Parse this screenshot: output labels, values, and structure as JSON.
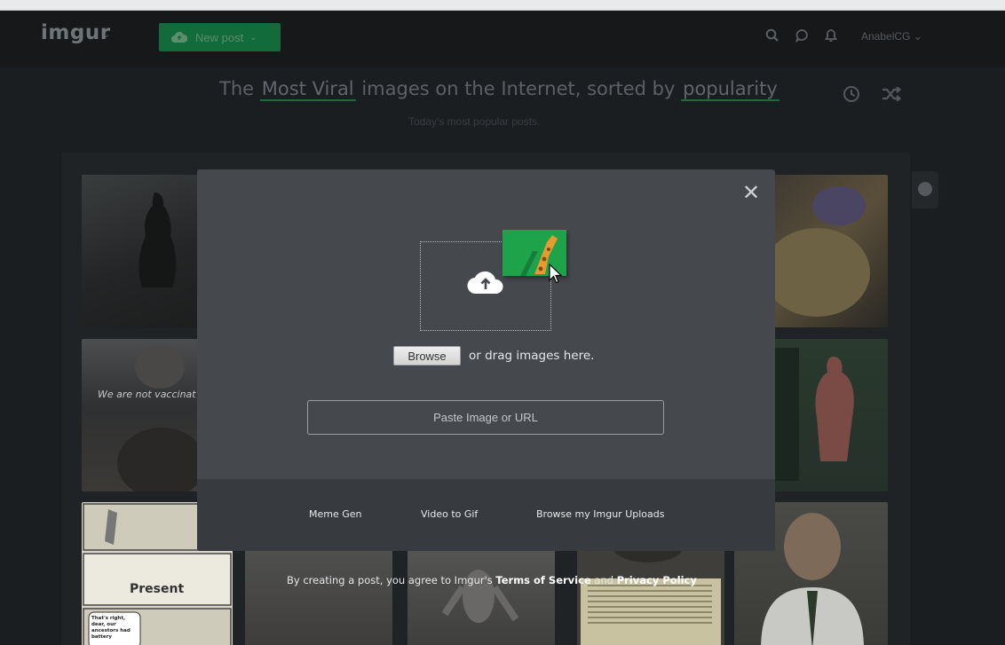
{
  "navbar": {
    "logo": "imgur",
    "new_post_label": "New post",
    "username": "AnabelCG",
    "icons": [
      "search-icon",
      "chat-icon",
      "bell-icon",
      "chevron-down-icon"
    ]
  },
  "header": {
    "headline_prefix": "The",
    "section": "Most Viral",
    "headline_middle": "images on the Internet, sorted by",
    "sort": "popularity",
    "subheadline": "Today's most popular posts.",
    "icons": [
      "clock-icon",
      "shuffle-icon"
    ]
  },
  "gallery": {
    "thumb_caption_1": "We are not vaccinat",
    "thumb_caption_2": "Present",
    "thumb_caption_3": "That's right, dear, our ancestors had battery"
  },
  "upload_modal": {
    "browse_label": "Browse",
    "drag_text": "or drag images here.",
    "url_placeholder": "Paste Image or URL",
    "footer_links": [
      "Meme Gen",
      "Video to Gif",
      "Browse my Imgur Uploads"
    ]
  },
  "terms": {
    "prefix": "By creating a post, you agree to Imgur's",
    "tos": "Terms of Service",
    "and": "and",
    "privacy": "Privacy Policy"
  },
  "colors": {
    "accent_green": "#1a6b3d",
    "modal_bg": "#45484d",
    "modal_footer_bg": "#373a3e",
    "giraffe_card": "#1ea24a"
  }
}
